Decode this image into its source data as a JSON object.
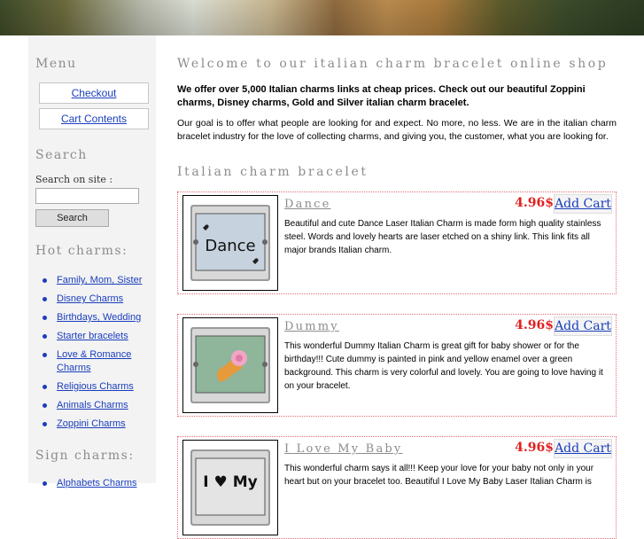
{
  "sidebar": {
    "menu_heading": "Menu",
    "checkout_label": "Checkout",
    "cart_label": "Cart Contents",
    "search_heading": "Search",
    "search_label": "Search on site :",
    "search_value": "",
    "search_button": "Search",
    "hot_heading": "Hot charms:",
    "hot_items": [
      "Family, Mom, Sister",
      "Disney Charms",
      "Birthdays, Wedding",
      "Starter bracelets",
      "Love & Romance Charms",
      "Religious Charms",
      "Animals Charms",
      "Zoppini Charms"
    ],
    "sign_heading": "Sign charms:",
    "sign_items": [
      "Alphabets Charms"
    ]
  },
  "main": {
    "title": "Welcome to our italian charm bracelet online shop",
    "intro_bold": "We offer over 5,000 Italian charms links at cheap prices. Check out our beautiful Zoppini charms, Disney charms, Gold and Silver italian charm bracelet.",
    "intro": "Our goal is to offer what people are looking for and expect. No more, no less. We are in the italian charm bracelet industry for the love of collecting charms, and giving you, the customer, what you are looking for.",
    "section_heading": "Italian charm bracelet",
    "products": [
      {
        "name": "Dance",
        "price": "4.96$",
        "cart": "Add Cart",
        "image_text": "Dance",
        "description": "Beautiful and cute Dance Laser Italian Charm is made form high quality stainless steel. Words and lovely hearts are laser etched on a shiny link. This link fits all major brands Italian charm."
      },
      {
        "name": "Dummy",
        "price": "4.96$",
        "cart": "Add Cart",
        "image_text": "",
        "description": "This wonderful Dummy Italian Charm is great gift for baby shower or for the birthday!!! Cute dummy is painted in pink and yellow enamel over a green background. This charm is very colorful and lovely. You are going to love having it on your bracelet."
      },
      {
        "name": "I Love My Baby",
        "price": "4.96$",
        "cart": "Add Cart",
        "image_text": "I ♥ My",
        "description": "This wonderful charm says it all!!! Keep your love for your baby not only in your heart but on your bracelet too. Beautiful I Love My Baby Laser Italian Charm is"
      }
    ]
  },
  "colors": {
    "heading": "#8c8c8c",
    "link": "#1a3ebc",
    "price": "#e02020",
    "border": "#e0707a",
    "sidebar_bg": "#f3f3f3"
  }
}
